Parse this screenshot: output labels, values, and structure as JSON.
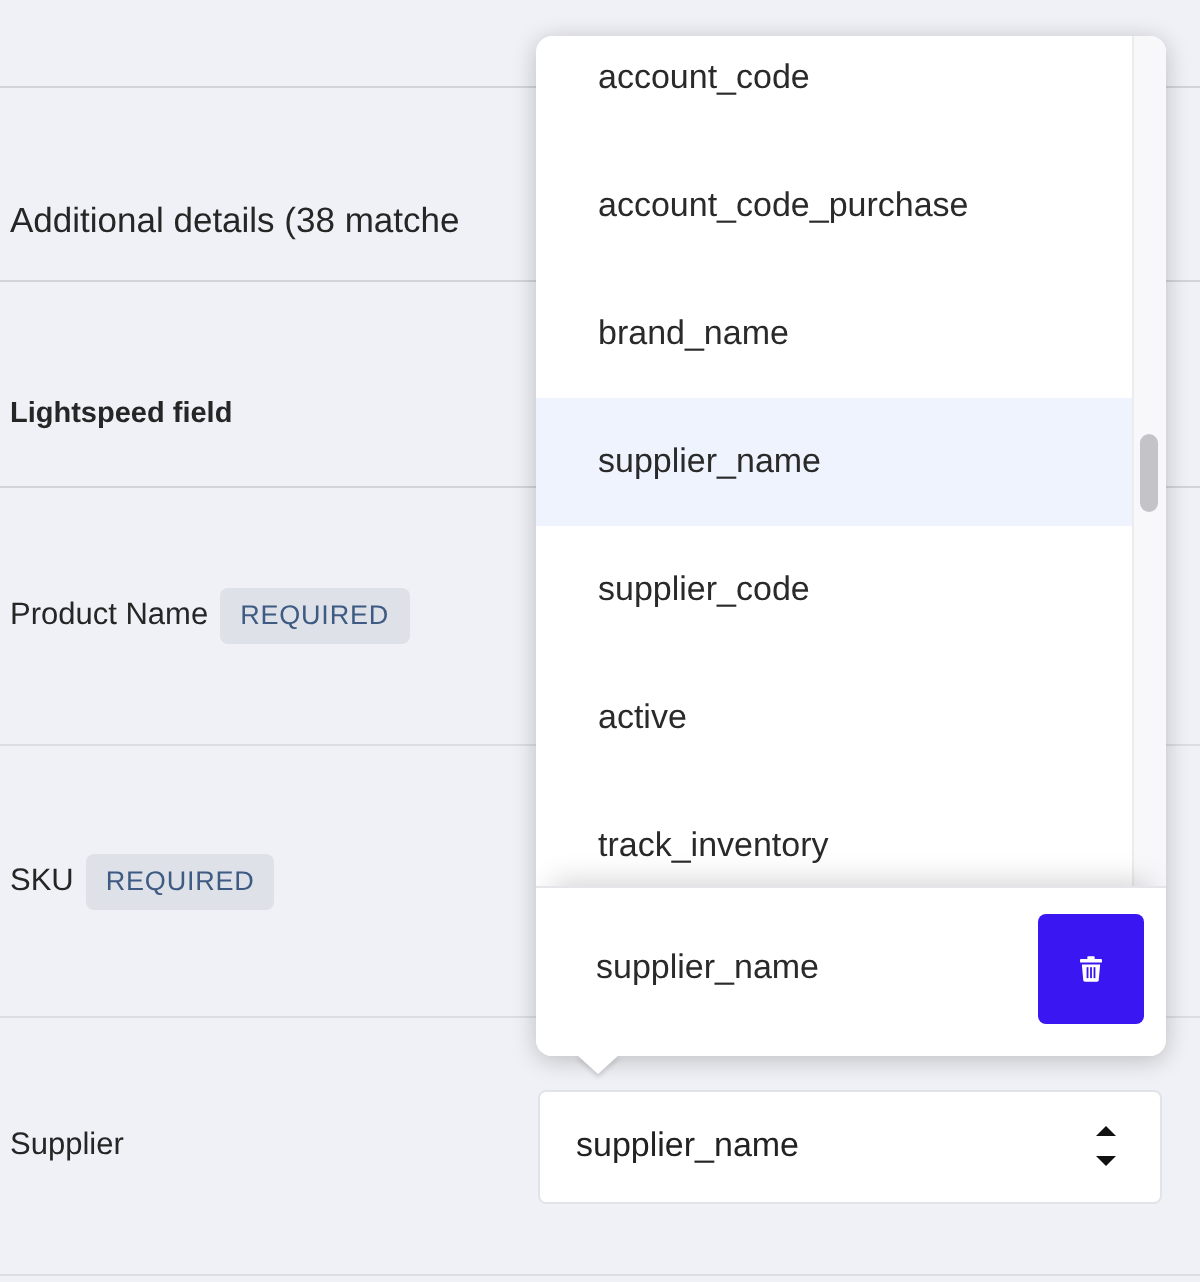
{
  "section": {
    "title": "Additional details (38 matche"
  },
  "table": {
    "header": "Lightspeed field",
    "rows": [
      {
        "kind": "badge",
        "label": "Product Name",
        "badge": "REQUIRED"
      },
      {
        "kind": "badge",
        "label": "SKU",
        "badge": "REQUIRED"
      },
      {
        "kind": "select",
        "label": "Supplier",
        "value": "supplier_name"
      }
    ]
  },
  "dropdown": {
    "open": true,
    "options": [
      {
        "label": "account_code",
        "selected": false
      },
      {
        "label": "account_code_purchase",
        "selected": false
      },
      {
        "label": "brand_name",
        "selected": false
      },
      {
        "label": "supplier_name",
        "selected": true
      },
      {
        "label": "supplier_code",
        "selected": false
      },
      {
        "label": "active",
        "selected": false
      },
      {
        "label": "track_inventory",
        "selected": false
      }
    ],
    "current": {
      "value": "supplier_name"
    }
  }
}
